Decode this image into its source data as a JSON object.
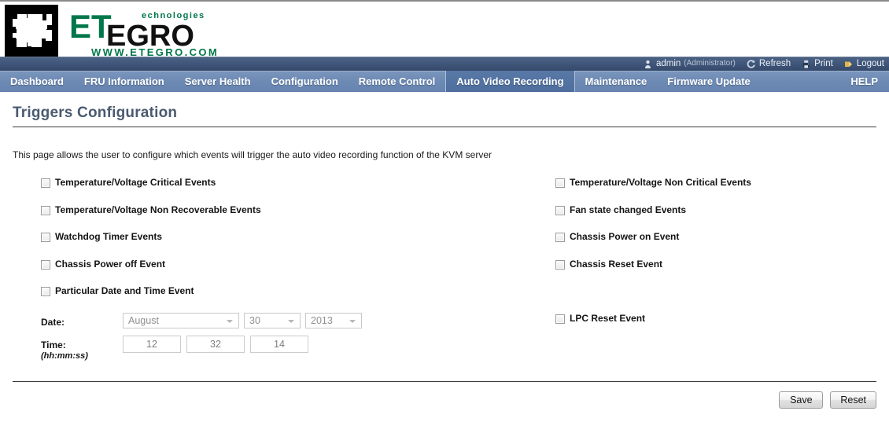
{
  "brand": {
    "name": "ETEGRO",
    "prefix": "ET",
    "suffix": "EGRO",
    "superscript": "echnologies",
    "url": "WWW.ETEGRO.COM",
    "green": "#00774a",
    "black": "#111111"
  },
  "utility": {
    "user_icon": "user-icon",
    "user_name": "admin",
    "user_role": "(Administrator)",
    "refresh_icon": "refresh-icon",
    "refresh_label": "Refresh",
    "print_icon": "print-icon",
    "print_label": "Print",
    "logout_icon": "logout-icon",
    "logout_label": "Logout"
  },
  "nav": {
    "items": [
      {
        "label": "Dashboard",
        "active": false
      },
      {
        "label": "FRU Information",
        "active": false
      },
      {
        "label": "Server Health",
        "active": false
      },
      {
        "label": "Configuration",
        "active": false
      },
      {
        "label": "Remote Control",
        "active": false
      },
      {
        "label": "Auto Video Recording",
        "active": true
      },
      {
        "label": "Maintenance",
        "active": false
      },
      {
        "label": "Firmware Update",
        "active": false
      }
    ],
    "help_label": "HELP"
  },
  "page": {
    "title": "Triggers Configuration",
    "description": "This page allows the user to configure which events will trigger the auto video recording function of the KVM server"
  },
  "triggers": {
    "left": [
      {
        "label": "Temperature/Voltage Critical Events",
        "checked": false
      },
      {
        "label": "Temperature/Voltage Non Recoverable Events",
        "checked": false
      },
      {
        "label": "Watchdog Timer Events",
        "checked": false
      },
      {
        "label": "Chassis Power off Event",
        "checked": false
      },
      {
        "label": "Particular Date and Time Event",
        "checked": false
      }
    ],
    "right": [
      {
        "label": "Temperature/Voltage Non Critical Events",
        "checked": false
      },
      {
        "label": "Fan state changed Events",
        "checked": false
      },
      {
        "label": "Chassis Power on Event",
        "checked": false
      },
      {
        "label": "Chassis Reset Event",
        "checked": false
      }
    ],
    "right_extra": [
      {
        "label": "LPC Reset Event",
        "checked": false
      }
    ]
  },
  "datetime": {
    "date_label": "Date:",
    "month_value": "August",
    "day_value": "30",
    "year_value": "2013",
    "time_label": "Time:",
    "time_hint": "(hh:mm:ss)",
    "hours": "12",
    "minutes": "32",
    "seconds": "14"
  },
  "footer": {
    "save_label": "Save",
    "reset_label": "Reset"
  }
}
